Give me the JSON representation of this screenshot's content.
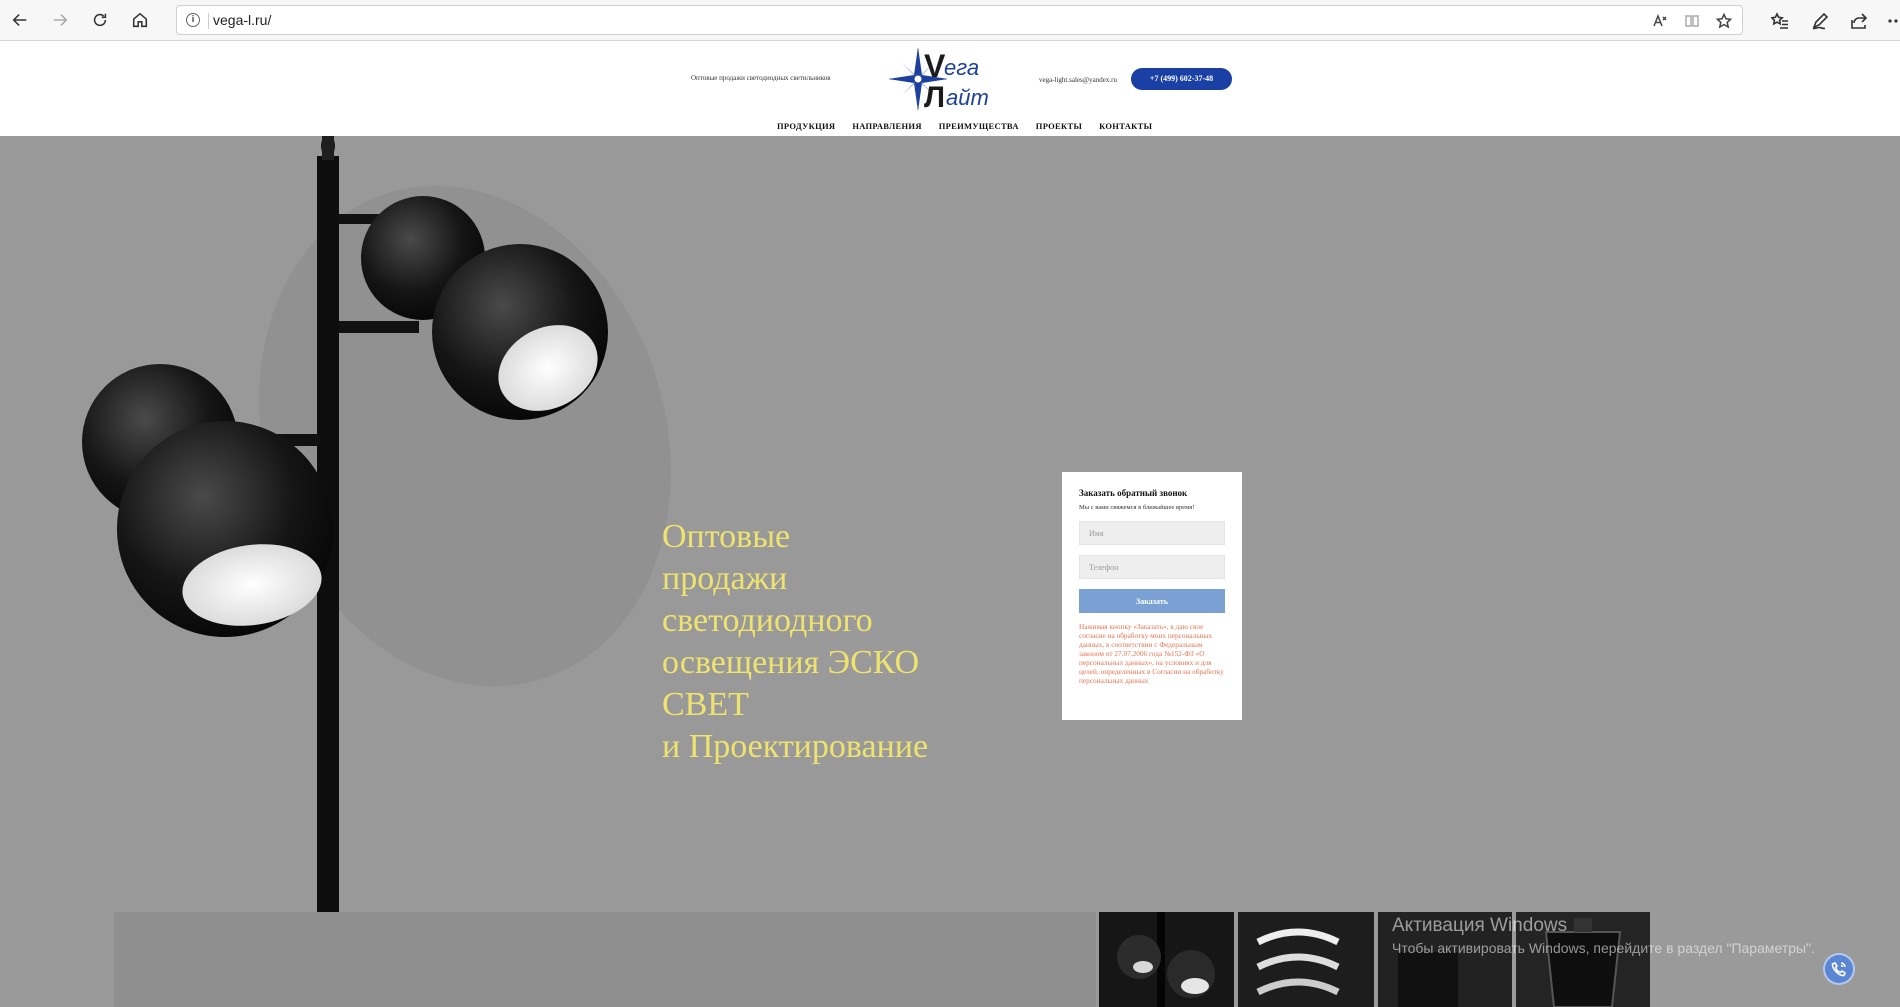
{
  "browser": {
    "url": "vega-l.ru/",
    "icons": [
      "back-icon",
      "forward-icon",
      "refresh-icon",
      "home-icon",
      "info-icon",
      "read-aloud-icon",
      "reader-view-icon",
      "favorite-star-icon",
      "favorites-icon",
      "pen-icon",
      "share-icon",
      "more-icon"
    ]
  },
  "header": {
    "tagline": "Оптовые продажи светодиодных светильников",
    "logo": {
      "line1": "ега",
      "line2": "айт",
      "letter1": "V",
      "letter2": "Л"
    },
    "email": "vega-light.sales@yandex.ru",
    "phone": "+7 (499) 602-37-48",
    "nav": [
      "ПРОДУКЦИЯ",
      "НАПРАВЛЕНИЯ",
      "ПРЕИМУЩЕСТВА",
      "ПРОЕКТЫ",
      "КОНТАКТЫ"
    ]
  },
  "hero": {
    "title_lines": [
      "Оптовые",
      "продажи",
      "светодиодного",
      "освещения ЭСКО",
      "СВЕТ",
      "и Проектирование"
    ]
  },
  "callback_form": {
    "title": "Заказать обратный звонок",
    "subtitle": "Мы с вами свяжемся в ближайшее время!",
    "name_placeholder": "Имя",
    "phone_placeholder": "Телефон",
    "submit_label": "Заказать",
    "consent": "Нажимая кнопку «Заказать», я даю свое согласие на обработку моих персональных данных, в соответствии с Федеральным законом от 27.07.2006 года №152-ФЗ «О персональных данных», на условиях и для целей, определенных в Согласии на обработку персональных данных"
  },
  "windows_watermark": {
    "title": "Активация Windows",
    "text": "Чтобы активировать Windows, перейдите в раздел \"Параметры\"."
  },
  "colors": {
    "accent": "#1a40a6",
    "hero_bg": "#999999",
    "hero_title": "#efe36f",
    "submit": "#7ba0d4",
    "consent": "#e8734f"
  }
}
